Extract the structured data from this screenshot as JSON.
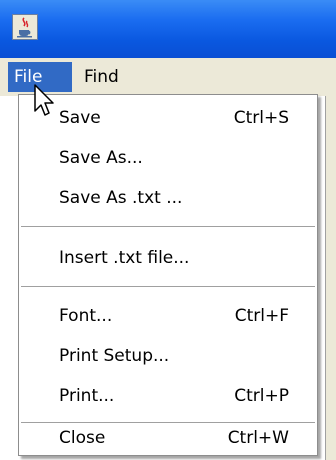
{
  "menubar": {
    "items": [
      {
        "label": "File",
        "active": true
      },
      {
        "label": "Find",
        "active": false
      }
    ]
  },
  "file_menu": {
    "items": [
      {
        "label": "Save",
        "shortcut": "Ctrl+S"
      },
      {
        "label": "Save As...",
        "shortcut": ""
      },
      {
        "label": "Save As .txt ...",
        "shortcut": ""
      },
      {
        "label": "Insert .txt file...",
        "shortcut": ""
      },
      {
        "label": "Font...",
        "shortcut": "Ctrl+F"
      },
      {
        "label": "Print Setup...",
        "shortcut": ""
      },
      {
        "label": "Print...",
        "shortcut": "Ctrl+P"
      },
      {
        "label": "Close",
        "shortcut": "Ctrl+W"
      }
    ]
  },
  "icons": {
    "app": "java-coffee-cup-icon",
    "pointer": "mouse-pointer-icon"
  },
  "colors": {
    "titlebar": "#0a58e0",
    "menu_highlight": "#316ac5",
    "menubar_bg": "#ece9d8"
  }
}
